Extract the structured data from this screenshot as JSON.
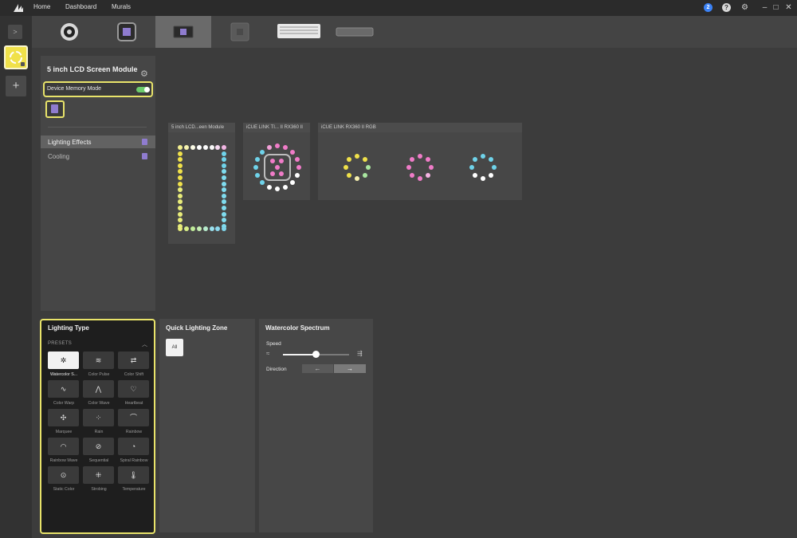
{
  "nav": {
    "home": "Home",
    "dashboard": "Dashboard",
    "murals": "Murals"
  },
  "window": {
    "help_blue": "2",
    "help": "?",
    "settings": "⚙",
    "minimize": "–",
    "maximize": "□",
    "close": "✕"
  },
  "rail": {
    "expand": ">",
    "add": "+"
  },
  "device_panel": {
    "title": "5 inch LCD Screen Module",
    "memory_mode_label": "Device Memory Mode",
    "menu": {
      "lighting_effects": "Lighting Effects",
      "cooling": "Cooling"
    }
  },
  "zones": {
    "lcd": "5 inch LCD...een Module",
    "rx360_ti": "iCUE LINK TI... II RX360 II",
    "rx360_rgb": "iCUE LINK RX360 II RGB"
  },
  "lighting_type": {
    "title": "Lighting Type",
    "presets_label": "PRESETS",
    "presets": [
      {
        "label": "Watercolor S...",
        "icon": "✲"
      },
      {
        "label": "Color Pulse",
        "icon": "≋"
      },
      {
        "label": "Color Shift",
        "icon": "⇄"
      },
      {
        "label": "Color Warp",
        "icon": "∿"
      },
      {
        "label": "Color Wave",
        "icon": "⋀"
      },
      {
        "label": "Heartbeat",
        "icon": "♡"
      },
      {
        "label": "Marquee",
        "icon": "✣"
      },
      {
        "label": "Rain",
        "icon": "⁘"
      },
      {
        "label": "Rainbow",
        "icon": "⌒"
      },
      {
        "label": "Rainbow Wave",
        "icon": "◠"
      },
      {
        "label": "Sequential",
        "icon": "⊘"
      },
      {
        "label": "Spiral Rainbow",
        "icon": "◔"
      },
      {
        "label": "Static Color",
        "icon": "⊙"
      },
      {
        "label": "Strobing",
        "icon": "⁜"
      },
      {
        "label": "Temperature",
        "icon": "🌡"
      }
    ]
  },
  "quick_zone": {
    "title": "Quick Lighting Zone",
    "all": "All"
  },
  "effect_settings": {
    "title": "Watercolor Spectrum",
    "speed_label": "Speed",
    "speed_value": 0.5,
    "direction_label": "Direction",
    "dir_left": "←",
    "dir_right": "→",
    "selected_direction": "right"
  },
  "colors": {
    "accent": "#e8e36a",
    "yellow": "#f0e14a",
    "cyan": "#6fd3ea",
    "pink": "#f07cc8",
    "green": "#a9e6a0"
  }
}
